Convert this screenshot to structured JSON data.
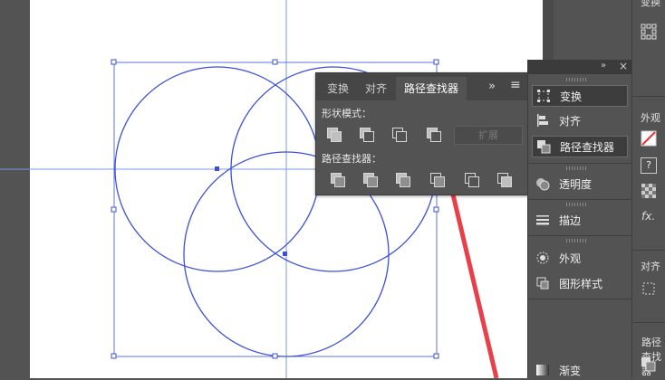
{
  "pathfinder_panel": {
    "tabs": [
      "变换",
      "对齐",
      "路径查找器"
    ],
    "active_tab": "路径查找器",
    "shape_modes_label": "形状模式：",
    "pathfinders_label": "路径查找器：",
    "expand_label": "扩展",
    "more_label": "»",
    "menu_label": "≡"
  },
  "dock": {
    "header_collapse": "»",
    "header_close": "×",
    "items": [
      {
        "label": "变换",
        "icon": "transform-icon",
        "selected": true
      },
      {
        "label": "对齐",
        "icon": "align-icon",
        "selected": false
      },
      {
        "label": "路径查找器",
        "icon": "pathfinder-icon",
        "selected": true
      },
      {
        "label": "透明度",
        "icon": "transparency-icon",
        "selected": false
      },
      {
        "label": "描边",
        "icon": "stroke-icon",
        "selected": false
      },
      {
        "label": "外观",
        "icon": "appearance-icon",
        "selected": false
      },
      {
        "label": "图形样式",
        "icon": "graphic-styles-icon",
        "selected": false
      },
      {
        "label": "渐变",
        "icon": "gradient-icon",
        "selected": false
      }
    ]
  },
  "strip": {
    "top_label": "变换",
    "appearance_label": "外观",
    "help_glyph": "?",
    "fx_glyph": "fx.",
    "align_label": "对齐",
    "pathfinder_label": "路径查找器"
  },
  "colors": {
    "selection_blue": "#3b4fd8",
    "guide_blue": "#5b8ad8",
    "annotation_red": "#e8404a",
    "panel_bg": "#535353"
  }
}
